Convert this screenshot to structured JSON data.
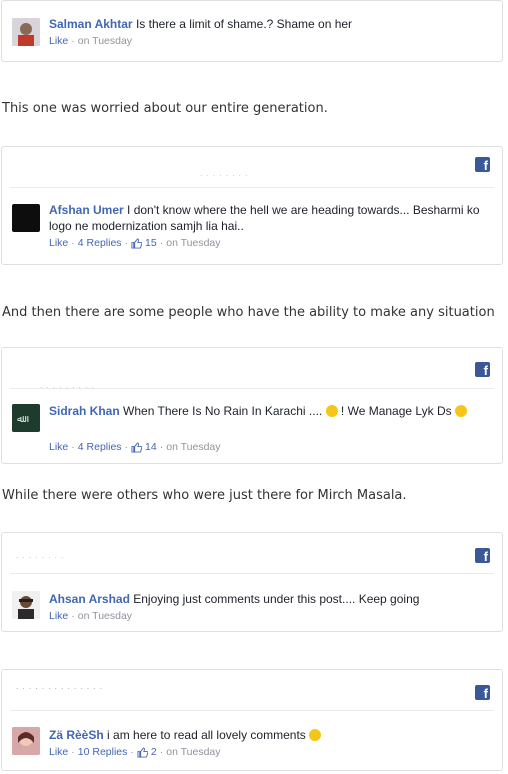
{
  "comments": {
    "c1": {
      "author": "Salman Akhtar",
      "text": "Is there a limit of shame.? Shame on her",
      "like": "Like",
      "time": "on Tuesday"
    },
    "c2": {
      "author": "Afshan Umer",
      "text": "I don't know where the hell we are heading towards... Besharmi ko logo ne modernization samjh lia hai..",
      "like": "Like",
      "replies": "4 Replies",
      "reactions": "15",
      "time": "on Tuesday"
    },
    "c3": {
      "author": "Sidrah Khan",
      "text": "When There Is No Rain In Karachi ....",
      "text2": "! We Manage Lyk Ds",
      "like": "Like",
      "replies": "4 Replies",
      "reactions": "14",
      "time": "on Tuesday"
    },
    "c4": {
      "author": "Ahsan Arshad",
      "text": "Enjoying just comments under this post.... Keep going",
      "like": "Like",
      "time": "on Tuesday"
    },
    "c5": {
      "author": "Zä RèèSh",
      "text": "i am here to read all lovely comments",
      "like": "Like",
      "replies": "10 Replies",
      "reactions": "2",
      "time": "on Tuesday"
    }
  },
  "paragraphs": {
    "p1": "This one was worried about our entire generation.",
    "p2": "And then there are some people who have the ability to make any situation",
    "p3": "While there were others who were just there for Mirch Masala."
  },
  "icons": {
    "facebook": "f"
  },
  "colors": {
    "author": "#4267b2",
    "brand": "#3b5998",
    "meta": "#90949c"
  }
}
